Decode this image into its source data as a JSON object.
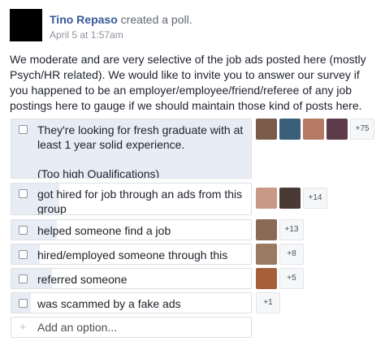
{
  "post": {
    "author_name": "Tino Repaso",
    "action": "created a poll.",
    "timestamp": "April 5 at 1:57am",
    "body": "We moderate and are very selective of the job ads posted here (mostly Psych/HR related). We would like to invite you to answer our survey if you happened to be an employer/employee/friend/referee of any job postings here to gauge if we should maintain those kind of posts here."
  },
  "poll": {
    "options": [
      {
        "label": "They're looking for fresh graduate with at least 1 year solid experience.\n\n(Too high Qualifications)",
        "more": "+75",
        "voters": [
          "#7a5a48",
          "#3a5f7a",
          "#b57a64",
          "#5f3a4a"
        ]
      },
      {
        "label": "got hired for job through an ads from this group",
        "more": "+14",
        "voters": [
          "#c79a86",
          "#4a3a35"
        ]
      },
      {
        "label": "helped someone find a job",
        "more": "+13",
        "voters": [
          "#8a6a55"
        ]
      },
      {
        "label": "hired/employed someone through this group",
        "more": "+8",
        "voters": [
          "#9a7a60"
        ]
      },
      {
        "label": "referred someone",
        "more": "+5",
        "voters": [
          "#a5603a"
        ]
      },
      {
        "label": "was scammed by a fake ads",
        "more": "+1",
        "voters": []
      }
    ],
    "add_option_placeholder": "Add an option...",
    "add_option_icon": "+"
  },
  "colors": {
    "link": "#365899",
    "poll_fill": "#e8edf5"
  }
}
